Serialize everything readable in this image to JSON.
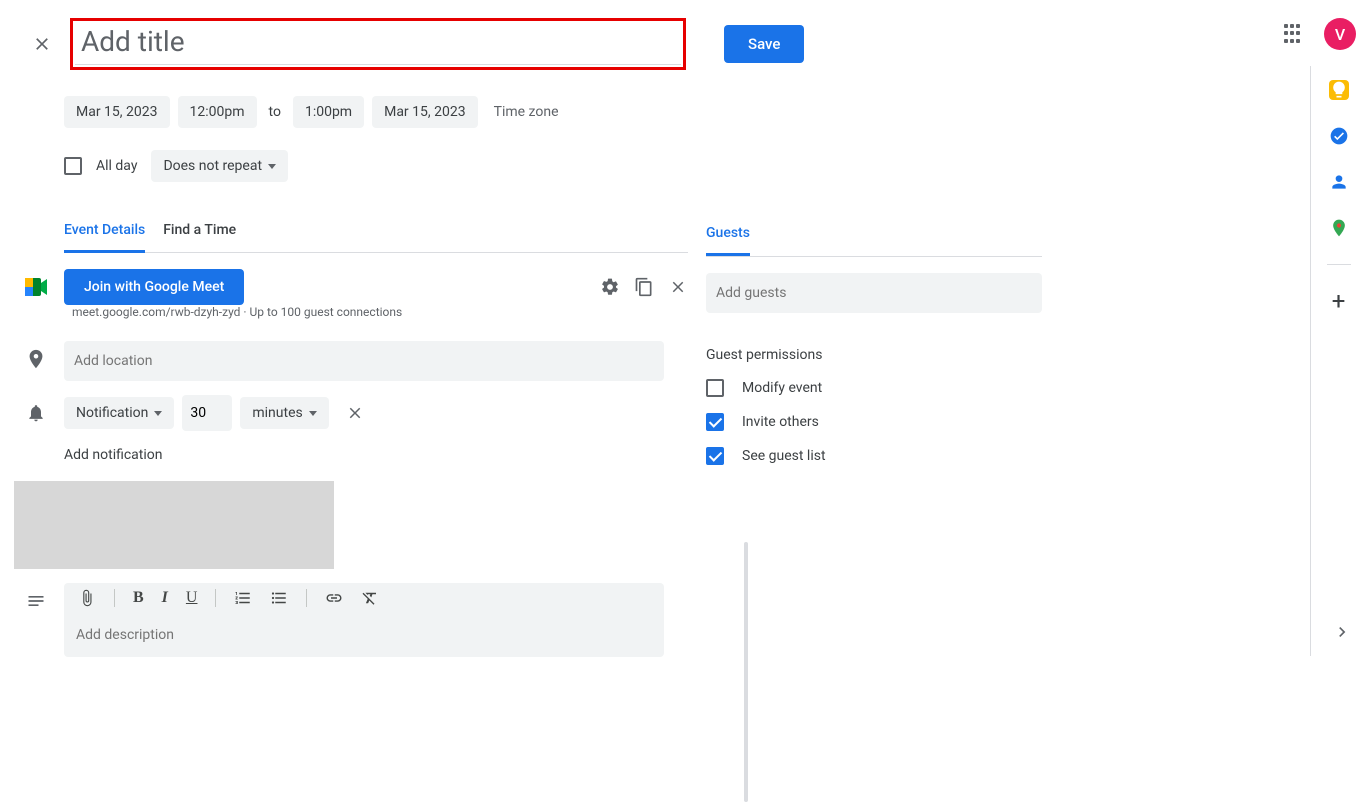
{
  "header": {
    "title_placeholder": "Add title",
    "save_label": "Save",
    "avatar_letter": "V"
  },
  "datetime": {
    "start_date": "Mar 15, 2023",
    "start_time": "12:00pm",
    "to_label": "to",
    "end_time": "1:00pm",
    "end_date": "Mar 15, 2023",
    "timezone_label": "Time zone",
    "allday_label": "All day",
    "repeat_label": "Does not repeat"
  },
  "tabs": {
    "event_details": "Event Details",
    "find_time": "Find a Time"
  },
  "meet": {
    "join_label": "Join with Google Meet",
    "url_line": "meet.google.com/rwb-dzyh-zyd · Up to 100 guest connections"
  },
  "location": {
    "placeholder": "Add location"
  },
  "notification": {
    "type_label": "Notification",
    "value": "30",
    "unit_label": "minutes",
    "add_label": "Add notification"
  },
  "description": {
    "placeholder": "Add description"
  },
  "guests": {
    "tab_label": "Guests",
    "input_placeholder": "Add guests",
    "permissions_title": "Guest permissions",
    "modify_label": "Modify event",
    "invite_label": "Invite others",
    "seelist_label": "See guest list"
  }
}
